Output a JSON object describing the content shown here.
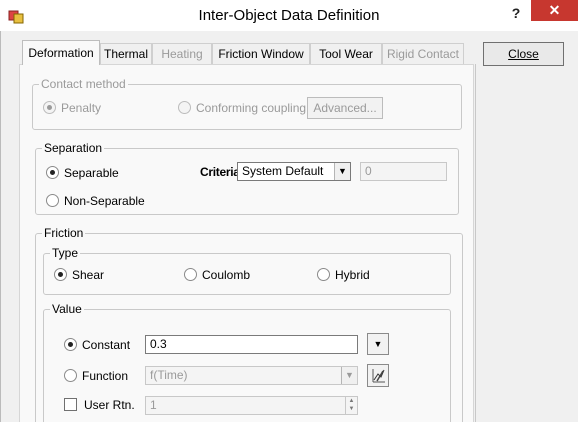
{
  "window": {
    "title": "Inter-Object Data Definition",
    "help_label": "?",
    "close_label": "✕"
  },
  "tabs": [
    {
      "label": "Deformation",
      "state": "active"
    },
    {
      "label": "Thermal",
      "state": "enabled"
    },
    {
      "label": "Heating",
      "state": "disabled"
    },
    {
      "label": "Friction Window",
      "state": "enabled"
    },
    {
      "label": "Tool Wear",
      "state": "enabled"
    },
    {
      "label": "Rigid Contact",
      "state": "disabled"
    }
  ],
  "close_button": {
    "label": "Close"
  },
  "contact_method": {
    "title": "Contact method",
    "options": [
      {
        "label": "Penalty",
        "selected": true
      },
      {
        "label": "Conforming coupling",
        "selected": false
      }
    ],
    "advanced_label": "Advanced..."
  },
  "separation": {
    "title": "Separation",
    "options": [
      {
        "label": "Separable",
        "selected": true
      },
      {
        "label": "Non-Separable",
        "selected": false
      }
    ],
    "criteria_label": "Criteria",
    "criteria_value": "System Default",
    "criteria_number": "0"
  },
  "friction": {
    "title": "Friction",
    "type": {
      "title": "Type",
      "options": [
        {
          "label": "Shear",
          "selected": true
        },
        {
          "label": "Coulomb",
          "selected": false
        },
        {
          "label": "Hybrid",
          "selected": false
        }
      ]
    },
    "value": {
      "title": "Value",
      "constant_label": "Constant",
      "constant_value": "0.3",
      "function_label": "Function",
      "function_value": "f(Time)",
      "user_rtn_label": "User Rtn.",
      "user_rtn_value": "1"
    }
  }
}
